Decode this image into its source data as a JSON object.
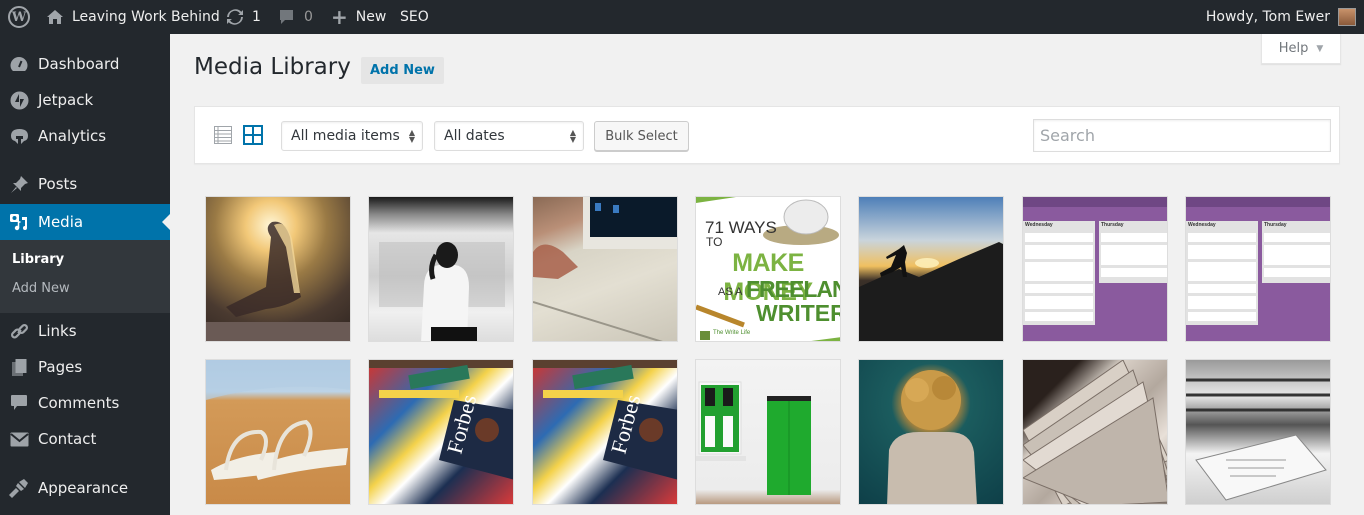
{
  "adminbar": {
    "site_name": "Leaving Work Behind",
    "updates_count": "1",
    "comments_count": "0",
    "new_label": "New",
    "seo_label": "SEO",
    "greeting": "Howdy, Tom Ewer"
  },
  "sidebar": {
    "items": [
      {
        "label": "Dashboard",
        "icon": "dashboard-icon"
      },
      {
        "label": "Jetpack",
        "icon": "jetpack-icon"
      },
      {
        "label": "Analytics",
        "icon": "analytics-icon"
      },
      {
        "label": "Posts",
        "icon": "pin-icon"
      },
      {
        "label": "Media",
        "icon": "media-icon",
        "active": true
      },
      {
        "label": "Links",
        "icon": "link-icon"
      },
      {
        "label": "Pages",
        "icon": "pages-icon"
      },
      {
        "label": "Comments",
        "icon": "comment-icon"
      },
      {
        "label": "Contact",
        "icon": "envelope-icon"
      },
      {
        "label": "Appearance",
        "icon": "paintbrush-icon"
      }
    ],
    "submenu": [
      {
        "label": "Library",
        "current": true
      },
      {
        "label": "Add New"
      }
    ]
  },
  "main": {
    "help_label": "Help",
    "page_title": "Media Library",
    "add_new_label": "Add New",
    "filters": {
      "type_selected": "All media items",
      "date_selected": "All dates",
      "bulk_select_label": "Bulk Select",
      "search_placeholder": "Search",
      "view_mode": "grid"
    },
    "accent_color": "#0073aa",
    "media": [
      {
        "alt": "Woman sitting in sunset light"
      },
      {
        "alt": "Woman waiting at subway platform"
      },
      {
        "alt": "Hand typing on laptop keyboard"
      },
      {
        "alt": "71 Ways to Make Money as a Freelance Writer",
        "line1": "71 WAYS",
        "line2": "TO",
        "line3": "MAKE MONEY",
        "line4": "AS A",
        "line5": "FREELANCE",
        "line6": "WRITER",
        "brand": "The Write Life"
      },
      {
        "alt": "Person jumping at sunset over mountains"
      },
      {
        "alt": "Trello board screenshot",
        "col1": "Wednesday",
        "col2": "Thursday"
      },
      {
        "alt": "Trello board screenshot",
        "col1": "Wednesday",
        "col2": "Thursday"
      },
      {
        "alt": "Flip-flops in sand dunes"
      },
      {
        "alt": "Stack of magazines with Forbes on top"
      },
      {
        "alt": "Stack of magazines with Forbes on top"
      },
      {
        "alt": "White wall with green door and window"
      },
      {
        "alt": "Curly-haired woman looking at the sea"
      },
      {
        "alt": "Fanned stack of papers"
      },
      {
        "alt": "Pile of papers in black and white"
      }
    ]
  }
}
